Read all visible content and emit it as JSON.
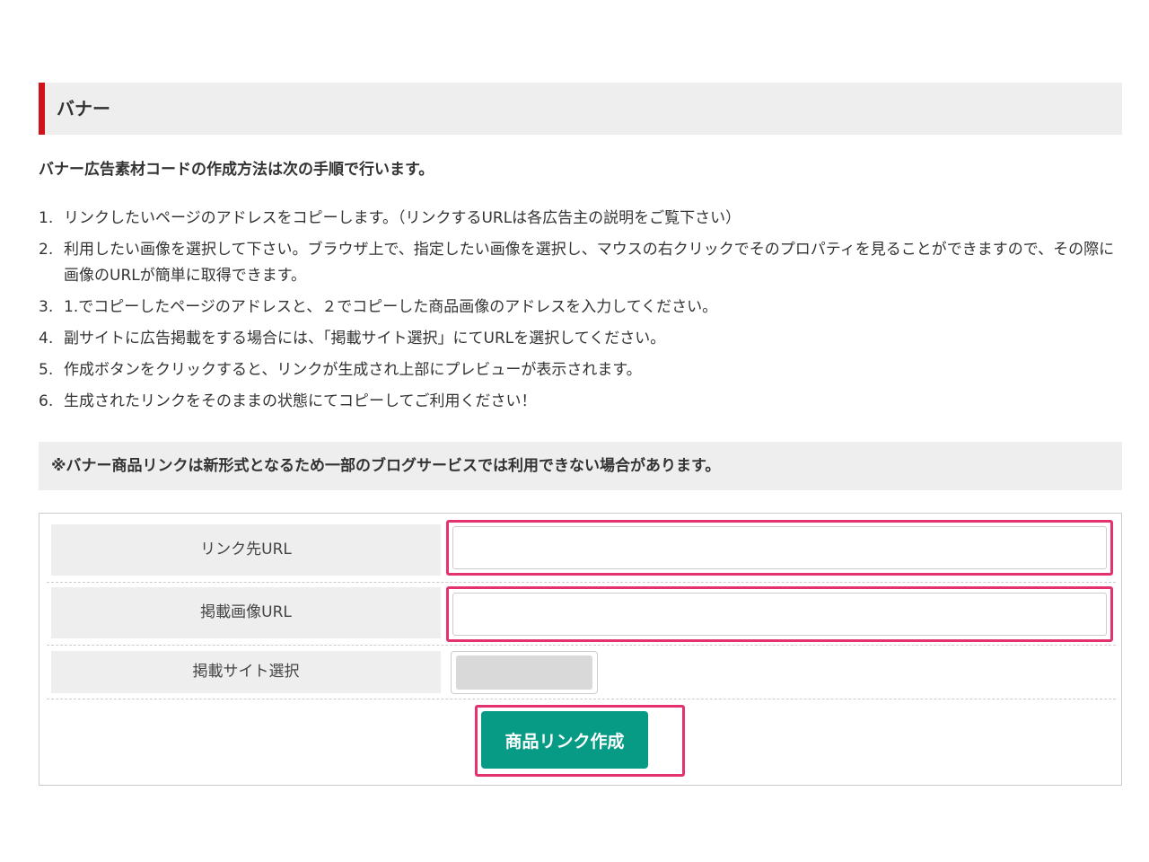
{
  "section": {
    "title": "バナー"
  },
  "intro": "バナー広告素材コードの作成方法は次の手順で行います。",
  "steps": [
    {
      "num": "1.",
      "text": "リンクしたいページのアドレスをコピーします。（リンクするURLは各広告主の説明をご覧下さい）"
    },
    {
      "num": "2.",
      "text": "利用したい画像を選択して下さい。ブラウザ上で、指定したい画像を選択し、マウスの右クリックでそのプロパティを見ることができますので、その際に画像のURLが簡単に取得できます。"
    },
    {
      "num": "3.",
      "text": "1.でコピーしたページのアドレスと、２でコピーした商品画像のアドレスを入力してください。"
    },
    {
      "num": "4.",
      "text": "副サイトに広告掲載をする場合には、「掲載サイト選択」にてURLを選択してください。"
    },
    {
      "num": "5.",
      "text": "作成ボタンをクリックすると、リンクが生成され上部にプレビューが表示されます。"
    },
    {
      "num": "6.",
      "text": "生成されたリンクをそのままの状態にてコピーしてご利用ください！"
    }
  ],
  "notice": "※バナー商品リンクは新形式となるため一部のブログサービスでは利用できない場合があります。",
  "form": {
    "link_url_label": "リンク先URL",
    "link_url_value": "",
    "image_url_label": "掲載画像URL",
    "image_url_value": "",
    "site_select_label": "掲載サイト選択",
    "site_select_value": "",
    "submit_label": "商品リンク作成"
  },
  "colors": {
    "accent_red": "#d0121b",
    "highlight_pink": "#e4326e",
    "button_green": "#079a85",
    "panel_gray": "#eeeeee"
  }
}
